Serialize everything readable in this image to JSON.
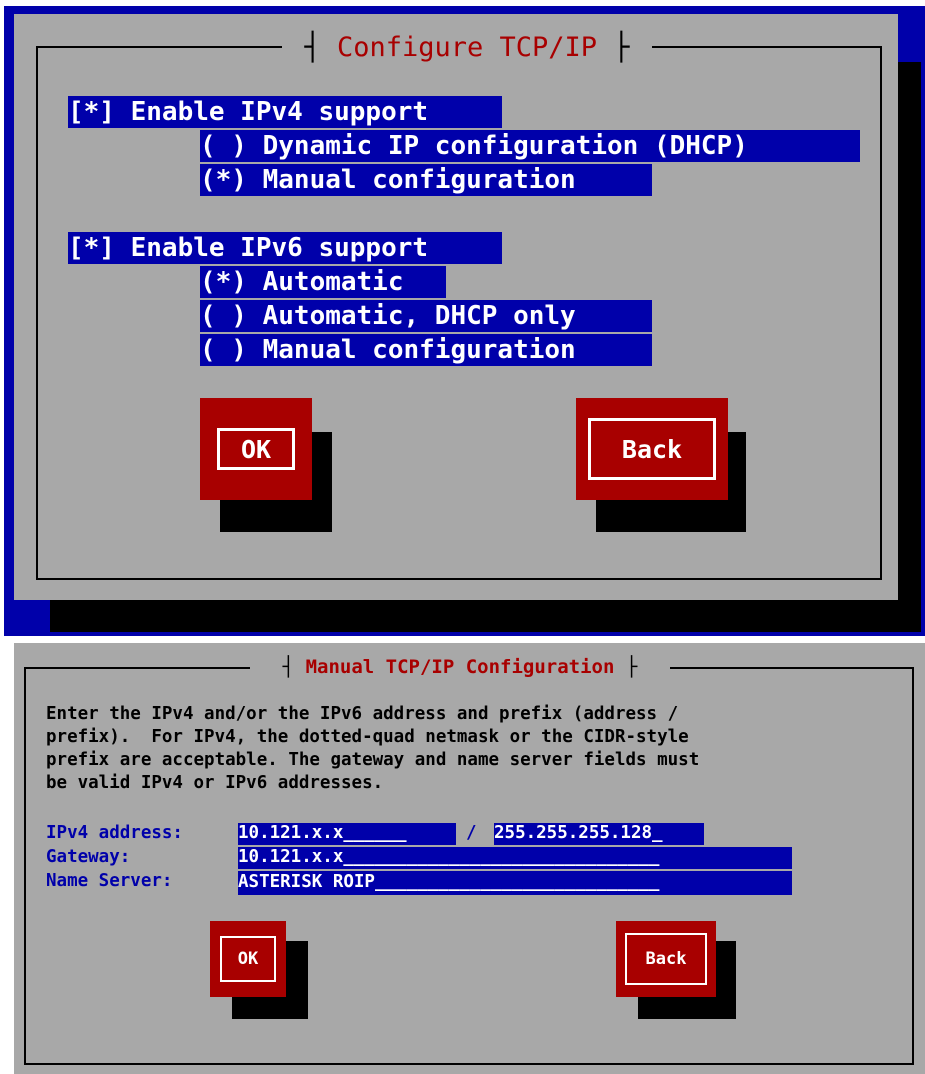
{
  "dialog1": {
    "title": "Configure TCP/IP",
    "options": [
      {
        "text": "[*] Enable IPv4 support"
      },
      {
        "text": "( ) Dynamic IP configuration (DHCP)"
      },
      {
        "text": "(*) Manual configuration"
      },
      {
        "text": "[*] Enable IPv6 support"
      },
      {
        "text": "(*) Automatic"
      },
      {
        "text": "( ) Automatic, DHCP only"
      },
      {
        "text": "( ) Manual configuration"
      }
    ],
    "ok_label": "OK",
    "back_label": "Back"
  },
  "dialog2": {
    "title": "Manual TCP/IP Configuration",
    "description": [
      "Enter the IPv4 and/or the IPv6 address and prefix (address /",
      "prefix).  For IPv4, the dotted-quad netmask or the CIDR-style",
      "prefix are acceptable. The gateway and name server fields must",
      "be valid IPv4 or IPv6 addresses."
    ],
    "ipv4_label": "IPv4 address:",
    "ipv4_value": "10.121.x.x______",
    "separator": "/",
    "netmask_value": "255.255.255.128_",
    "gateway_label": "Gateway:",
    "gateway_value": "10.121.x.x______________________________",
    "nameserver_label": "Name Server:",
    "nameserver_value": "ASTERISK ROIP___________________________",
    "ok_label": "OK",
    "back_label": "Back"
  },
  "colors": {
    "screen_blue": "#0000aa",
    "panel_gray": "#a8a8a8",
    "button_red": "#a80000",
    "title_red": "#a80000"
  }
}
